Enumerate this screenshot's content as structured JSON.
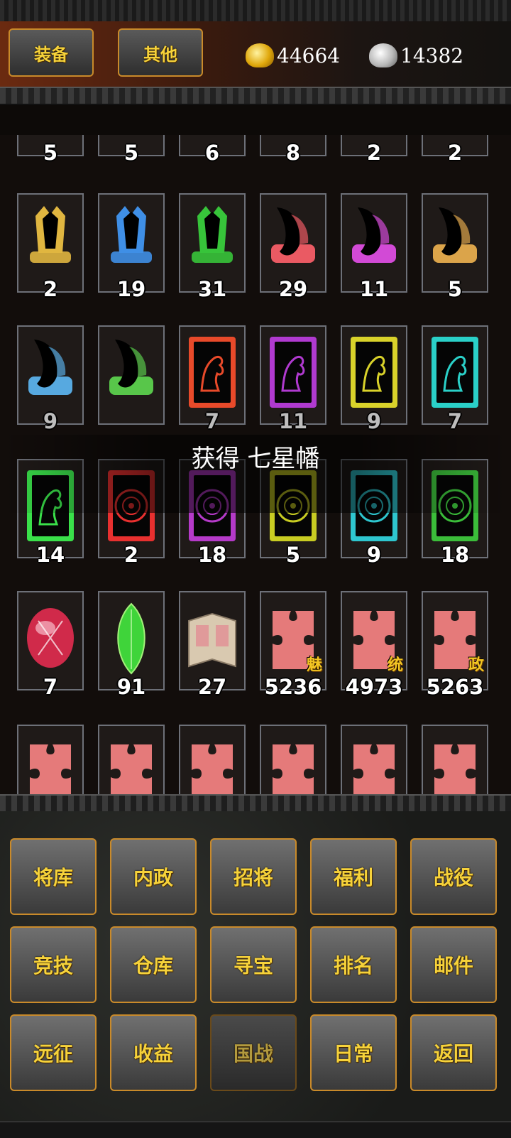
{
  "tabs": {
    "equipment": "装备",
    "other": "其他"
  },
  "currency": {
    "gold": "44664",
    "silver": "14382"
  },
  "toast": "获得 七星幡",
  "partial_row_counts": [
    "5",
    "5",
    "6",
    "8",
    "2",
    "2"
  ],
  "items": [
    {
      "icon": "banner-gold-icon",
      "count": "2",
      "color": "#e0b640",
      "shape": "banner"
    },
    {
      "icon": "banner-blue-icon",
      "count": "19",
      "color": "#3f8fe6",
      "shape": "banner"
    },
    {
      "icon": "banner-green-icon",
      "count": "31",
      "color": "#37c43a",
      "shape": "banner"
    },
    {
      "icon": "scroll-red-icon",
      "count": "29",
      "color": "#ea5a63",
      "shape": "scroll"
    },
    {
      "icon": "scroll-magenta-icon",
      "count": "11",
      "color": "#d24ad6",
      "shape": "scroll"
    },
    {
      "icon": "scroll-gold-icon",
      "count": "5",
      "color": "#dba44a",
      "shape": "scroll"
    },
    {
      "icon": "scroll-blue-icon",
      "count": "9",
      "color": "#57a9e0",
      "shape": "scroll",
      "dim": true
    },
    {
      "icon": "scroll-green-icon",
      "count": "",
      "color": "#58c64a",
      "shape": "scroll"
    },
    {
      "icon": "horse-card-red-icon",
      "count": "7",
      "color": "#e84a2a",
      "shape": "card",
      "dim": true
    },
    {
      "icon": "horse-card-purple-icon",
      "count": "11",
      "color": "#b03ad0",
      "shape": "card",
      "dim": true
    },
    {
      "icon": "horse-card-yellow-icon",
      "count": "9",
      "color": "#d9d22a",
      "shape": "card",
      "dim": true
    },
    {
      "icon": "horse-card-cyan-icon",
      "count": "7",
      "color": "#2ad0c8",
      "shape": "card",
      "dim": true
    },
    {
      "icon": "horse-card-green-icon",
      "count": "14",
      "color": "#3ae04a",
      "shape": "card"
    },
    {
      "icon": "seal-card-red-icon",
      "count": "2",
      "color": "#e8302f",
      "shape": "seal"
    },
    {
      "icon": "seal-card-purple-icon",
      "count": "18",
      "color": "#b53ac9",
      "shape": "seal"
    },
    {
      "icon": "seal-card-yellow-icon",
      "count": "5",
      "color": "#c8cc22",
      "shape": "seal"
    },
    {
      "icon": "seal-card-cyan-icon",
      "count": "9",
      "color": "#2ec6cf",
      "shape": "seal"
    },
    {
      "icon": "seal-card-green-icon",
      "count": "18",
      "color": "#3bbd3a",
      "shape": "seal"
    },
    {
      "icon": "ruby-gem-icon",
      "count": "7",
      "color": "#d02a4a",
      "shape": "gem"
    },
    {
      "icon": "emerald-gem-icon",
      "count": "91",
      "color": "#3fd43a",
      "shape": "leafgem"
    },
    {
      "icon": "book-icon",
      "count": "27",
      "color": "#d9c9b0",
      "shape": "book"
    },
    {
      "icon": "puzzle-charm-icon",
      "count": "5236",
      "color": "#e57a7a",
      "shape": "puzzle",
      "tag": "魅"
    },
    {
      "icon": "puzzle-command-icon",
      "count": "4973",
      "color": "#e57a7a",
      "shape": "puzzle",
      "tag": "统"
    },
    {
      "icon": "puzzle-politics-icon",
      "count": "5263",
      "color": "#e57a7a",
      "shape": "puzzle",
      "tag": "政"
    }
  ],
  "menu": [
    [
      "将库",
      "内政",
      "招将",
      "福利",
      "战役"
    ],
    [
      "竞技",
      "仓库",
      "寻宝",
      "排名",
      "邮件"
    ],
    [
      "远征",
      "收益",
      "国战",
      "日常",
      "返回"
    ]
  ],
  "menu_disabled": "国战"
}
